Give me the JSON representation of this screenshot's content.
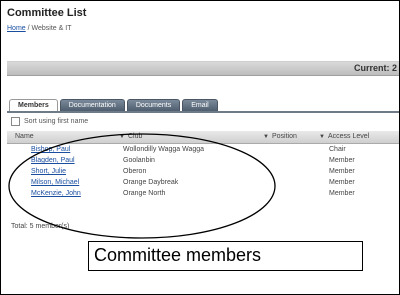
{
  "page": {
    "title": "Committee List",
    "breadcrumb": {
      "home": "Home",
      "sep": " / ",
      "current": "Website & IT"
    },
    "current_label": "Current: 2"
  },
  "tabs": [
    {
      "label": "Members",
      "active": true
    },
    {
      "label": "Documentation",
      "active": false
    },
    {
      "label": "Documents",
      "active": false
    },
    {
      "label": "Email",
      "active": false
    }
  ],
  "sort": {
    "label": "Sort using first name"
  },
  "table": {
    "headers": {
      "name": "Name",
      "club": "Club",
      "position": "Position",
      "access": "Access Level"
    },
    "rows": [
      {
        "name": "Bishop, Paul",
        "club": "Wollondilly Wagga Wagga",
        "position": "",
        "access": "Chair"
      },
      {
        "name": "Blagden, Paul",
        "club": "Goolanbin",
        "position": "",
        "access": "Member"
      },
      {
        "name": "Short, Julie",
        "club": "Oberon",
        "position": "",
        "access": "Member"
      },
      {
        "name": "Milson, Michael",
        "club": "Orange Daybreak",
        "position": "",
        "access": "Member"
      },
      {
        "name": "McKenzie, John",
        "club": "Orange North",
        "position": "",
        "access": "Member"
      }
    ],
    "total": "Total: 5 member(s)"
  },
  "annotation": {
    "caption": "Committee members"
  }
}
